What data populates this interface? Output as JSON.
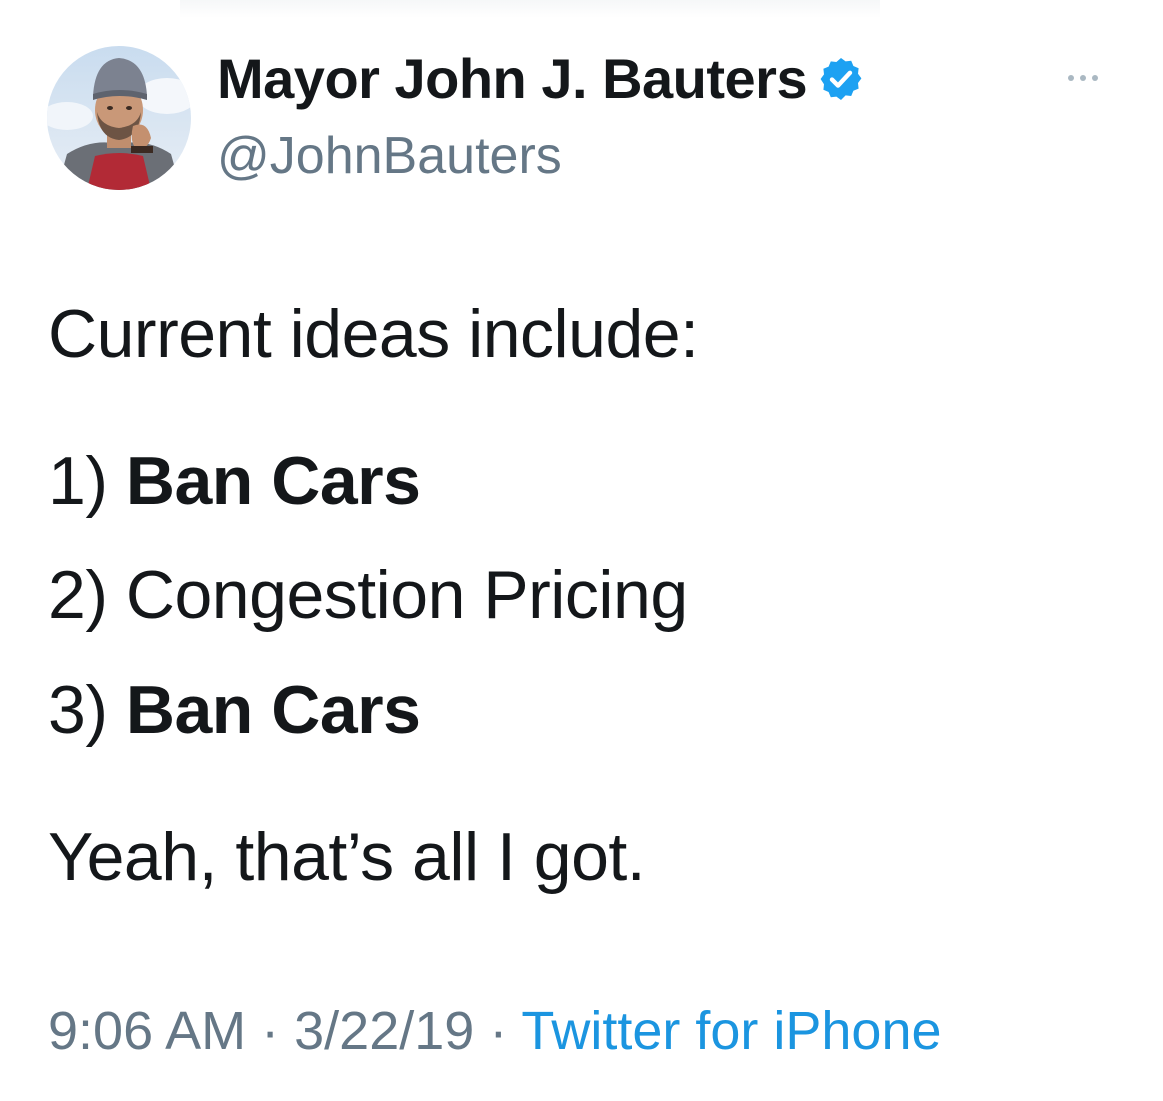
{
  "author": {
    "display_name": "Mayor John J. Bauters",
    "handle": "@JohnBauters",
    "verified": true,
    "verified_color": "#1da1f2"
  },
  "tweet": {
    "intro": "Current ideas include:",
    "items": [
      {
        "number": "1)",
        "text": "Ban Cars",
        "bold": true
      },
      {
        "number": "2)",
        "text": "Congestion Pricing",
        "bold": false
      },
      {
        "number": "3)",
        "text": "Ban Cars",
        "bold": true
      }
    ],
    "outro": "Yeah, that’s all I got."
  },
  "meta": {
    "time": "9:06 AM",
    "separator": "·",
    "date": "3/22/19",
    "source": "Twitter for iPhone"
  },
  "colors": {
    "text": "#14171a",
    "secondary": "#657786",
    "link": "#1b95e0"
  }
}
